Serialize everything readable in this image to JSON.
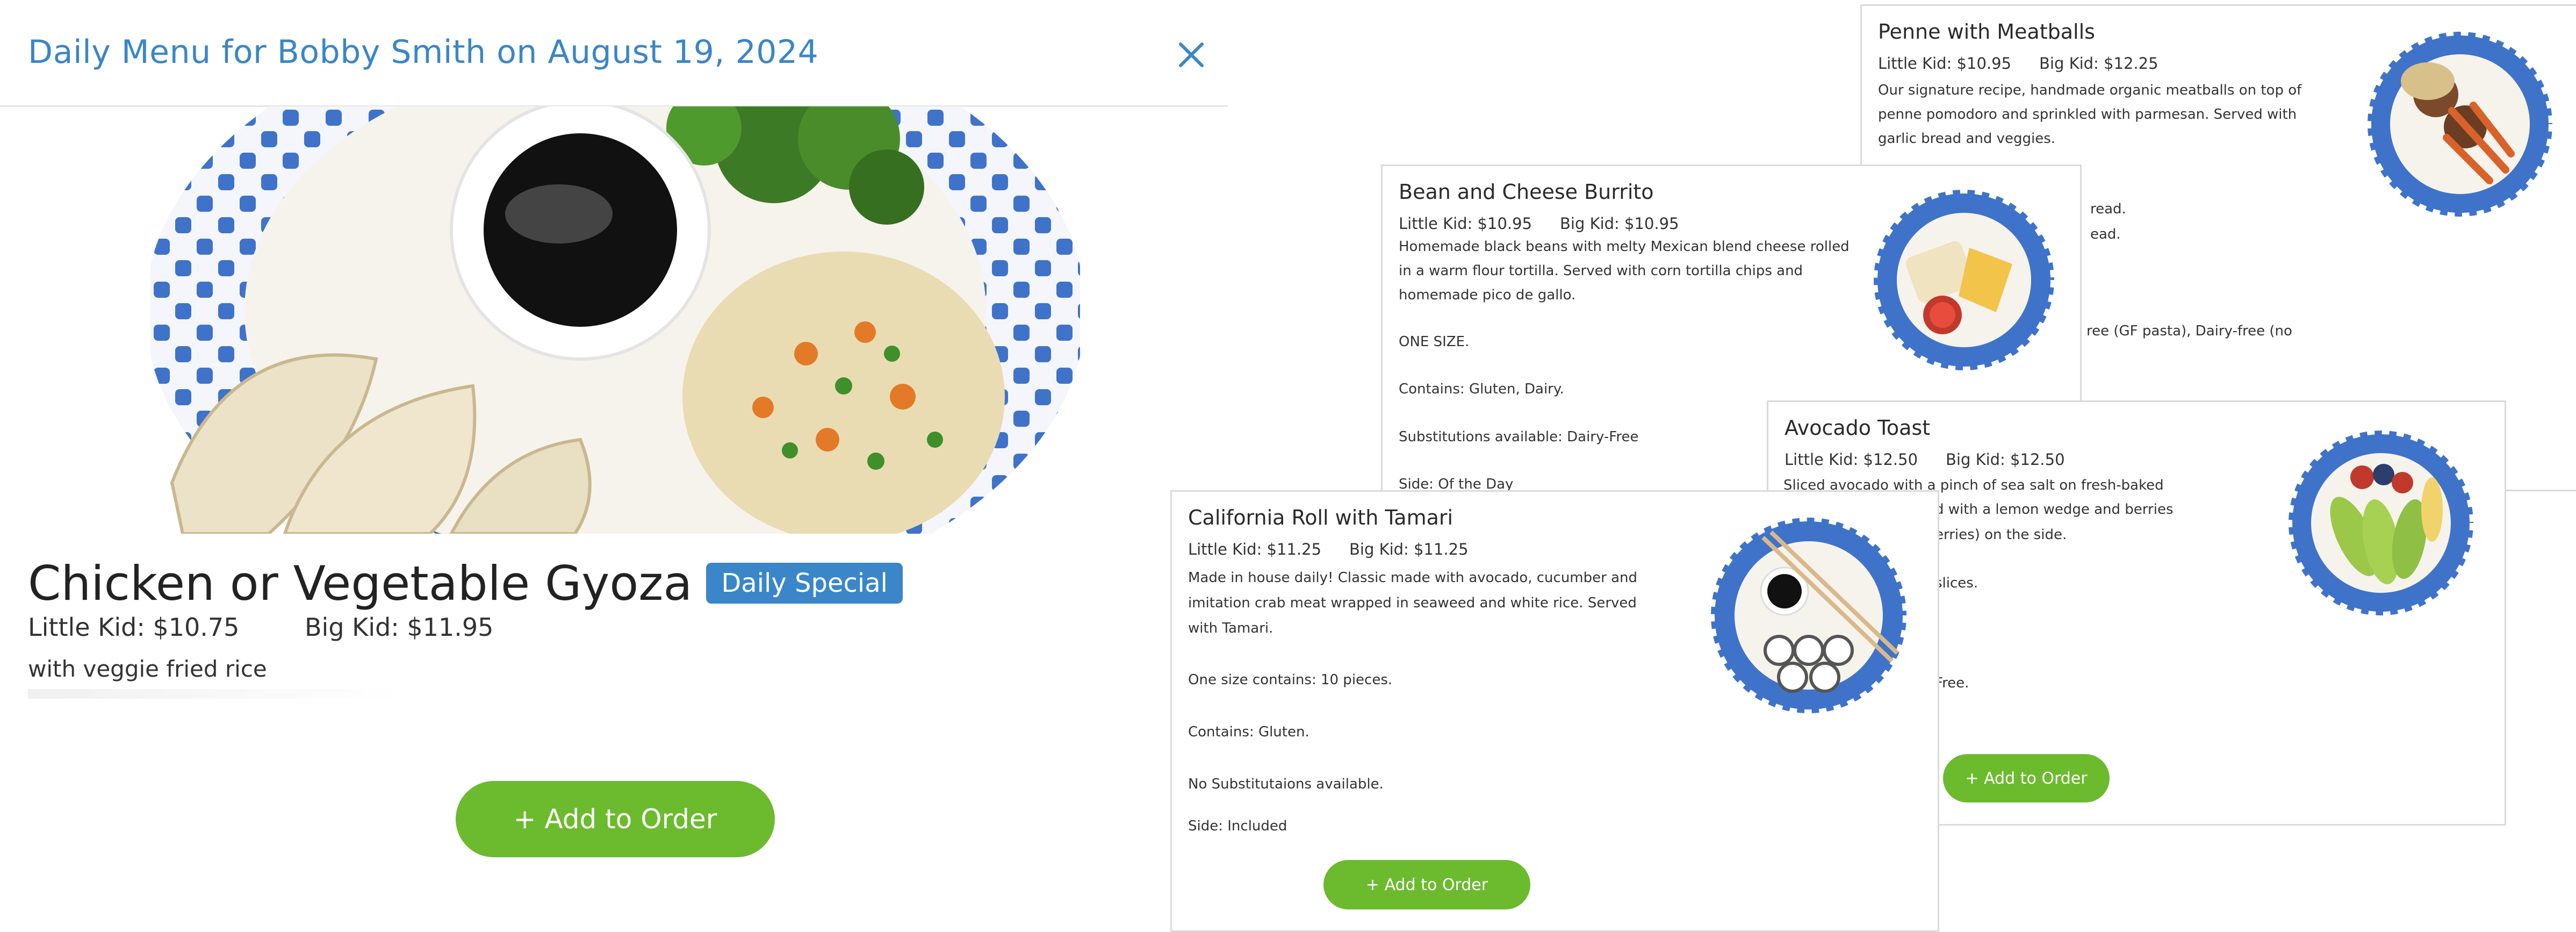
{
  "modal": {
    "title": "Daily Menu for Bobby Smith on August 19, 2024",
    "dish_name": "Chicken or Vegetable Gyoza",
    "badge": "Daily Special",
    "little_kid": "Little Kid: $10.75",
    "big_kid": "Big Kid: $11.95",
    "description": "with veggie fried rice",
    "add_button": "+ Add to Order"
  },
  "cards": {
    "penne": {
      "title": "Penne with Meatballs",
      "little_kid": "Little Kid: $10.95",
      "big_kid": "Big Kid: $12.25",
      "lines": [
        "Our signature recipe, handmade organic meatballs on top of",
        "penne pomodoro and sprinkled with parmesan. Served with",
        "garlic bread and veggies."
      ],
      "fragments": [
        "read.",
        "ead.",
        "ree (GF pasta), Dairy-free (no"
      ]
    },
    "burrito": {
      "title": "Bean and Cheese Burrito",
      "little_kid": "Little Kid: $10.95",
      "big_kid": "Big Kid: $10.95",
      "lines": [
        "Homemade black beans with melty Mexican blend cheese rolled",
        "in a warm flour tortilla. Served with corn tortilla chips and",
        "homemade pico de gallo.",
        "ONE SIZE.",
        "Contains: Gluten, Dairy.",
        "Substitutions available: Dairy-Free",
        "Side: Of the Day"
      ]
    },
    "avocado": {
      "title": "Avocado Toast",
      "little_kid": "Little Kid: $12.50",
      "big_kid": "Big Kid: $12.50",
      "fragments": [
        "Sliced avocado with a pinch of sea salt on fresh-baked",
        "d with a lemon wedge and berries",
        "erries) on the side.",
        "slices.",
        "Free."
      ],
      "add_button": "+ Add to Order"
    },
    "california": {
      "title": "California Roll with Tamari",
      "little_kid": "Little Kid: $11.25",
      "big_kid": "Big Kid: $11.25",
      "lines": [
        "Made in house daily! Classic made with avocado, cucumber and",
        "imitation crab meat wrapped in seaweed and white rice. Served",
        "with Tamari.",
        "One size contains: 10 pieces.",
        "Contains: Gluten.",
        "No Substitutaions available.",
        "Side: Included"
      ],
      "add_button": "+ Add to Order"
    }
  },
  "colors": {
    "accent_blue": "#3a86c8",
    "add_green": "#6cba2e"
  }
}
